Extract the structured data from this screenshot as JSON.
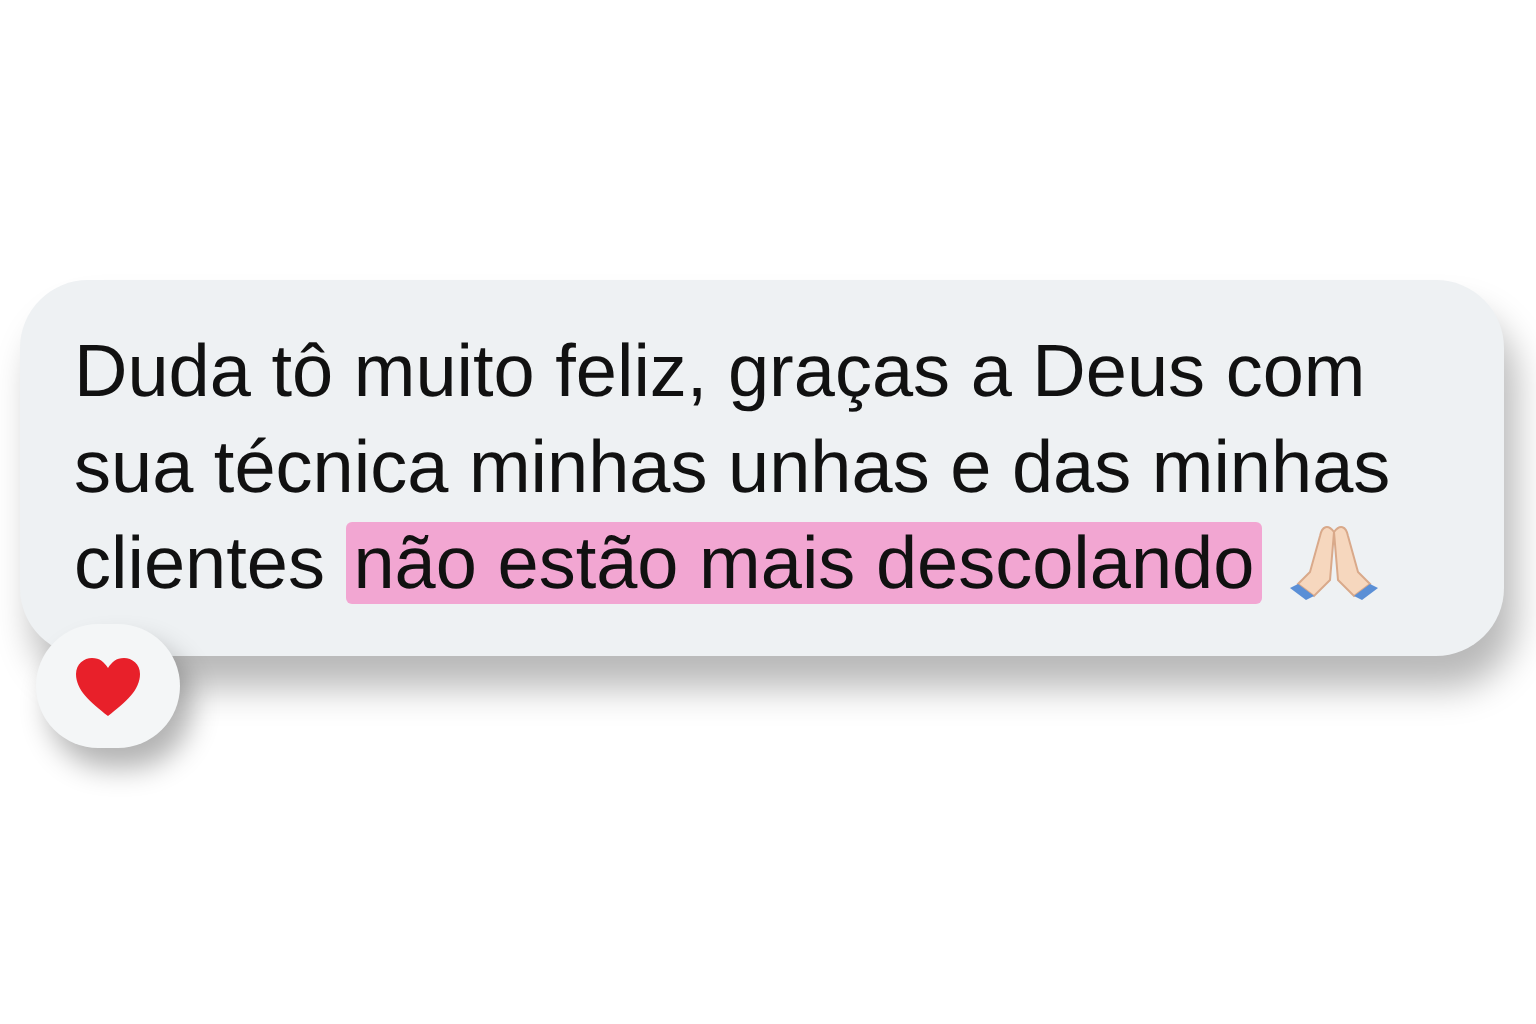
{
  "message": {
    "segments": [
      {
        "text": "Duda tô muito feliz, graças a Deus com sua técnica minhas unhas e das minhas clientes",
        "highlighted": false
      },
      {
        "text": "não estão mais descolando",
        "highlighted": true
      }
    ]
  },
  "reaction": {
    "kind": "heart"
  }
}
